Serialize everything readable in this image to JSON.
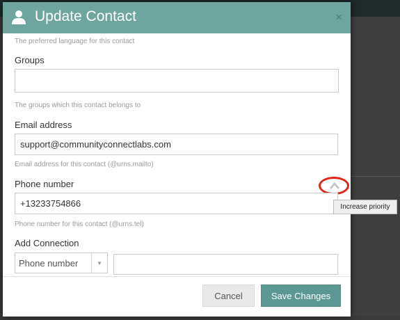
{
  "modal": {
    "title": "Update Contact",
    "close_glyph": "×"
  },
  "form": {
    "language_help": "The preferred language for this contact",
    "groups": {
      "label": "Groups",
      "value": "",
      "help": "The groups which this contact belongs to"
    },
    "email": {
      "label": "Email address",
      "value": "support@communityconnectlabs.com",
      "help": "Email address for this contact (@urns.mailto)"
    },
    "phone": {
      "label": "Phone number",
      "value": "+13233754866",
      "help": "Phone number for this contact (@urns.tel)"
    },
    "connection": {
      "label": "Add Connection",
      "type_selected": "Phone number",
      "value": ""
    }
  },
  "tooltip": {
    "text": "Increase priority"
  },
  "footer": {
    "cancel_label": "Cancel",
    "save_label": "Save Changes"
  },
  "icons": {
    "header": "user-icon",
    "priority": "chevron-up-icon",
    "select": "caret-down-icon"
  },
  "colors": {
    "header": "#6fa59f",
    "primary_button": "#5c9893",
    "annotation": "#e0241b"
  }
}
